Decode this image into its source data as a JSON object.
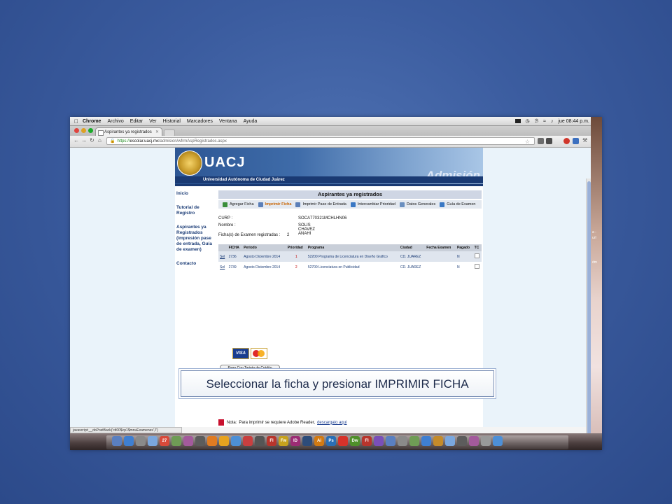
{
  "menubar": {
    "app": "Chrome",
    "items": [
      "Archivo",
      "Editar",
      "Ver",
      "Historial",
      "Marcadores",
      "Ventana",
      "Ayuda"
    ],
    "clock": "jue 08:44 p.m."
  },
  "browser": {
    "tab_title": "Aspirantes ya registrados",
    "url_scheme": "https://",
    "url_host": "escolar.uacj.mx",
    "url_path": "/admision/wfrmAspRegistrados.aspx",
    "status_text": "javascript:__doPostBack('ctl00$cp1$mnuExamenes','l')"
  },
  "header": {
    "logo_text": "UACJ",
    "university": "Universidad Autónoma de Ciudad Juárez",
    "section": "Admisión"
  },
  "sidebar": {
    "items": [
      "Inicio",
      "Tutorial de Registro",
      "Aspirantes ya Registrados (impresión pase de entrada, Guía de examen)",
      "Contacto"
    ]
  },
  "panel": {
    "title": "Aspirantes ya registrados",
    "actions": [
      {
        "label": "Agregar Ficha",
        "icon": "add-icon",
        "color": "#3b8f3b"
      },
      {
        "label": "Imprimir Ficha",
        "icon": "printer-icon",
        "color": "#5b7fb8"
      },
      {
        "label": "Imprimir Pase de Entrada",
        "icon": "printer-icon",
        "color": "#5b7fb8"
      },
      {
        "label": "Intercambiar Prioridad",
        "icon": "swap-icon",
        "color": "#3a78c4"
      },
      {
        "label": "Datos Generales",
        "icon": "document-icon",
        "color": "#6a8fbf"
      },
      {
        "label": "Guía de Examen",
        "icon": "check-icon",
        "color": "#3a78c4"
      }
    ],
    "curp_label": "CURP :",
    "curp_value": "SOCA770321MCHLHN06",
    "nombre_label": "Nombre :",
    "nombre_value": "SOLIS CHAVEZ ANAHI",
    "fichas_label": "Ficha(s) de Examen registradas :",
    "fichas_value": "2"
  },
  "table": {
    "headers": [
      "",
      "FICHA",
      "Periodo",
      "Prioridad",
      "Programa",
      "Ciudad",
      "Fecha Examen",
      "Pagado",
      "TC"
    ],
    "rows": [
      {
        "sel": "Sel",
        "ficha": "2736",
        "periodo": "Agosto Diciembre 2014",
        "prioridad": "1",
        "programa": "52200 Programa de Licenciatura en Diseño Gráfico",
        "ciudad": "CD. JUAREZ",
        "fecha": "",
        "pagado": "N"
      },
      {
        "sel": "Sel",
        "ficha": "2739",
        "periodo": "Agosto Diciembre 2014",
        "prioridad": "2",
        "programa": "52700 Licenciatura en Publicidad",
        "ciudad": "CD. JUAREZ",
        "fecha": "",
        "pagado": "N"
      }
    ]
  },
  "payment": {
    "visa": "VISA",
    "button": "Pago Con Tarjeta de Crédito"
  },
  "adobe": {
    "prefix": "Nota:",
    "text": "Para imprimir se requiere Adobe Reader,",
    "link": "descargalo aqui"
  },
  "side_text": [
    "a -",
    "url",
    "dm"
  ],
  "dock_icons": [
    {
      "label": "",
      "color": "#5a7fc0"
    },
    {
      "label": "",
      "color": "#3f7fd1"
    },
    {
      "label": "",
      "color": "#8a8a8a"
    },
    {
      "label": "",
      "color": "#7aa7de"
    },
    {
      "label": "27",
      "color": "#d84a3a"
    },
    {
      "label": "",
      "color": "#6f9c55"
    },
    {
      "label": "",
      "color": "#a35a9c"
    },
    {
      "label": "",
      "color": "#5c5c5c"
    },
    {
      "label": "",
      "color": "#e07b22"
    },
    {
      "label": "",
      "color": "#e8a31f"
    },
    {
      "label": "",
      "color": "#4d8fd6"
    },
    {
      "label": "",
      "color": "#c93f3f"
    },
    {
      "label": "",
      "color": "#555555"
    },
    {
      "label": "Fl",
      "color": "#b8352c"
    },
    {
      "label": "Fw",
      "color": "#c7a21e"
    },
    {
      "label": "ID",
      "color": "#9b2c74"
    },
    {
      "label": "",
      "color": "#2d4c7a"
    },
    {
      "label": "Ai",
      "color": "#d27a12"
    },
    {
      "label": "Ps",
      "color": "#2a6fb5"
    },
    {
      "label": "",
      "color": "#d6322a"
    },
    {
      "label": "Dw",
      "color": "#4f8f2a"
    },
    {
      "label": "Fl",
      "color": "#b8352c"
    },
    {
      "label": "",
      "color": "#7a4fb8"
    },
    {
      "label": "",
      "color": "#5a7fc0"
    },
    {
      "label": "",
      "color": "#8a8a8a"
    },
    {
      "label": "",
      "color": "#6f9c55"
    },
    {
      "label": "",
      "color": "#3f7fd1"
    },
    {
      "label": "",
      "color": "#c48b2a"
    },
    {
      "label": "",
      "color": "#7aa7de"
    },
    {
      "label": "",
      "color": "#5c5c5c"
    },
    {
      "label": "",
      "color": "#a35a9c"
    },
    {
      "label": "",
      "color": "#999999"
    },
    {
      "label": "",
      "color": "#4d8fd6"
    }
  ],
  "caption": "Seleccionar la ficha y presionar IMPRIMIR FICHA"
}
